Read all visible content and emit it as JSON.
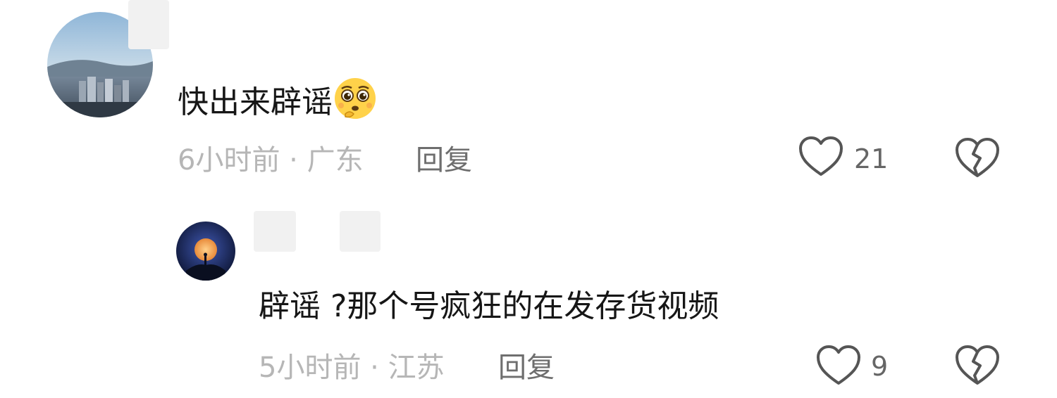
{
  "comments": [
    {
      "text": "快出来辟谣",
      "emoji": "pleading-face-emoji",
      "time_location": "6小时前 · 广东",
      "reply_label": "回复",
      "like_count": "21",
      "icons": {
        "like": "heart-outline-icon",
        "dislike": "broken-heart-icon"
      }
    },
    {
      "text": "辟谣 ?那个号疯狂的在发存货视频",
      "time_location": "5小时前 · 江苏",
      "reply_label": "回复",
      "like_count": "9",
      "icons": {
        "like": "heart-outline-icon",
        "dislike": "broken-heart-icon"
      }
    }
  ],
  "colors": {
    "meta_text": "#b6b6b6",
    "reply_text": "#6e6e6e",
    "icon_stroke": "#555555",
    "comment_text": "#161616"
  }
}
